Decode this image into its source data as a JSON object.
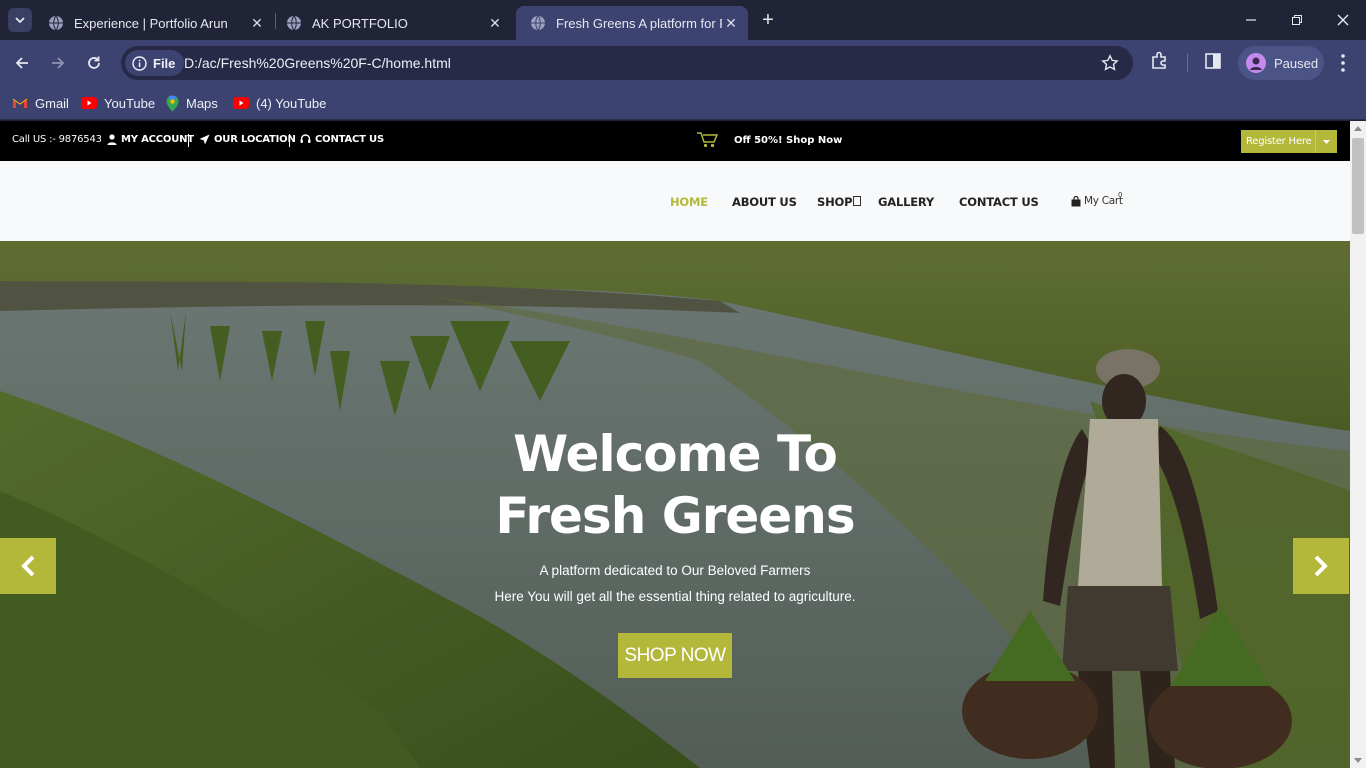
{
  "browser": {
    "tabs": [
      {
        "title": "Experience | Portfolio Arun",
        "active": false
      },
      {
        "title": "AK PORTFOLIO",
        "active": false
      },
      {
        "title": "Fresh Greens A platform for Farmers",
        "active": true
      }
    ],
    "address": {
      "scheme_chip": "File",
      "url": "D:/ac/Fresh%20Greens%20F-C/home.html"
    },
    "profile_status": "Paused",
    "bookmarks": [
      {
        "label": "Gmail",
        "icon": "gmail-icon"
      },
      {
        "label": "YouTube",
        "icon": "youtube-icon"
      },
      {
        "label": "Maps",
        "icon": "maps-icon"
      },
      {
        "label": "(4) YouTube",
        "icon": "youtube-icon"
      }
    ]
  },
  "site": {
    "topbar": {
      "call": "Call US :- 9876543",
      "account": "MY ACCOUNT",
      "location": "OUR LOCATION",
      "contact": "CONTACT US",
      "offer": "Off 50%! Shop Now",
      "register": "Register Here"
    },
    "nav": {
      "items": [
        "HOME",
        "ABOUT US",
        "SHOP",
        "GALLERY",
        "CONTACT US"
      ],
      "active_item": "HOME",
      "cart_label": "My Cart",
      "cart_count": "0"
    },
    "hero": {
      "title_line1": "Welcome To",
      "title_line2": "Fresh Greens",
      "subtitle1": "A platform dedicated to Our Beloved Farmers",
      "subtitle2": "Here You will get all the essential thing related to agriculture.",
      "cta": "SHOP NOW"
    },
    "colors": {
      "accent": "#b4b83a",
      "topbar_bg": "#000000",
      "nav_bg": "#f8f9fa"
    }
  }
}
